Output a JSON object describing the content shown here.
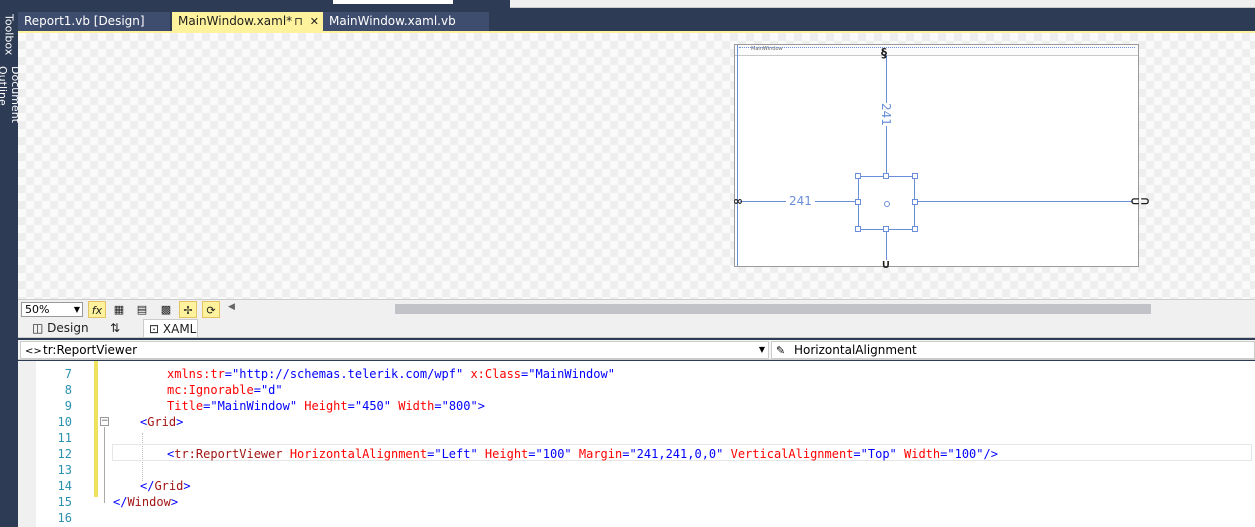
{
  "side_tabs": {
    "toolbox": "Toolbox",
    "document_outline": "Document Outline"
  },
  "document_tabs": [
    {
      "label": "Report1.vb [Design]"
    },
    {
      "label": "MainWindow.xaml*",
      "pin": "⊓",
      "close": "✕"
    },
    {
      "label": "MainWindow.xaml.vb"
    }
  ],
  "designer": {
    "window_title": "MainWindow",
    "margin_top": "241",
    "margin_left": "241"
  },
  "zoom": {
    "value": "50%"
  },
  "toolbar_icons": [
    "fx-icon",
    "grid-icon",
    "snap-grid-icon",
    "artboard-icon",
    "snap-lines-icon",
    "refresh-icon"
  ],
  "split_tabs": {
    "design": "Design",
    "swap": "⇅",
    "xaml": "XAML"
  },
  "navigation": {
    "element": "tr:ReportViewer",
    "member": "HorizontalAlignment"
  },
  "editor": {
    "line_numbers": [
      "7",
      "8",
      "9",
      "10",
      "11",
      "12",
      "13",
      "14",
      "15",
      "16"
    ],
    "lines": {
      "l7_attr": "xmlns:tr",
      "l7_eq": "=",
      "l7_val": "\"http://schemas.telerik.com/wpf\"",
      "l7_attr2": " x:Class",
      "l7_val2": "\"MainWindow\"",
      "l8_attr": "mc:Ignorable",
      "l8_eq": "=",
      "l8_val": "\"d\"",
      "l9_attr": "Title",
      "l9_val": "\"MainWindow\"",
      "l9_attr2": " Height",
      "l9_val2": "\"450\"",
      "l9_attr3": " Width",
      "l9_val3": "\"800\"",
      "l9_close": ">",
      "l10_open": "<",
      "l10_tag": "Grid",
      "l10_close": ">",
      "l12_open": "<",
      "l12_tag": "tr:ReportViewer",
      "l12_a1": " HorizontalAlignment",
      "l12_v1": "\"Left\"",
      "l12_a2": " Height",
      "l12_v2": "\"100\"",
      "l12_a3": " Margin",
      "l12_v3": "\"241,241,0,0\"",
      "l12_a4": " VerticalAlignment",
      "l12_v4": "\"Top\"",
      "l12_a5": " Width",
      "l12_v5": "\"100\"",
      "l12_close": "/>",
      "l14_open": "</",
      "l14_tag": "Grid",
      "l14_close": ">",
      "l15_open": "</",
      "l15_tag": "Window",
      "l15_close": ">"
    }
  },
  "colors": {
    "tab_active": "#fff29d",
    "chrome": "#2d3b55",
    "guide": "#6a8fd9"
  }
}
